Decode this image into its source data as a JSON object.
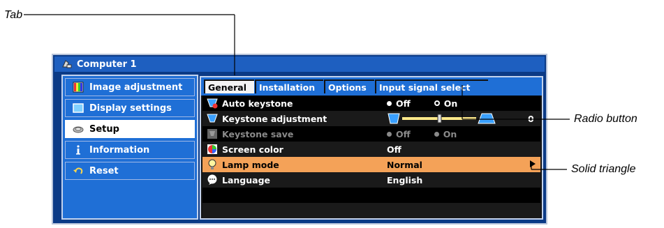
{
  "callouts": {
    "tab": "Tab",
    "radio_button": "Radio button",
    "solid_triangle": "Solid triangle"
  },
  "window": {
    "title": "Computer 1"
  },
  "left_menu": {
    "items": [
      {
        "label": "Image adjustment",
        "icon": "color-grid-icon"
      },
      {
        "label": "Display settings",
        "icon": "monitor-icon"
      },
      {
        "label": "Setup",
        "icon": "setup-icon"
      },
      {
        "label": "Information",
        "icon": "info-icon"
      },
      {
        "label": "Reset",
        "icon": "reset-arrow-icon"
      }
    ],
    "selected": "Setup"
  },
  "tabs": [
    {
      "label": "General"
    },
    {
      "label": "Installation"
    },
    {
      "label": "Options"
    },
    {
      "label": "Input signal select"
    }
  ],
  "rows": {
    "auto_keystone": {
      "label": "Auto keystone",
      "off": "Off",
      "on": "On",
      "selected": "Off"
    },
    "keystone_adjustment": {
      "label": "Keystone adjustment",
      "value": "0",
      "slider_fraction": 0.5
    },
    "keystone_save": {
      "label": "Keystone save",
      "off": "Off",
      "on": "On"
    },
    "screen_color": {
      "label": "Screen color",
      "value": "Off"
    },
    "lamp_mode": {
      "label": "Lamp mode",
      "value": "Normal"
    },
    "language": {
      "label": "Language",
      "value": "English"
    }
  },
  "colors": {
    "highlight": "#f4a258",
    "menu_blue": "#1f6fd6",
    "frame_blue": "#0b3a86"
  }
}
